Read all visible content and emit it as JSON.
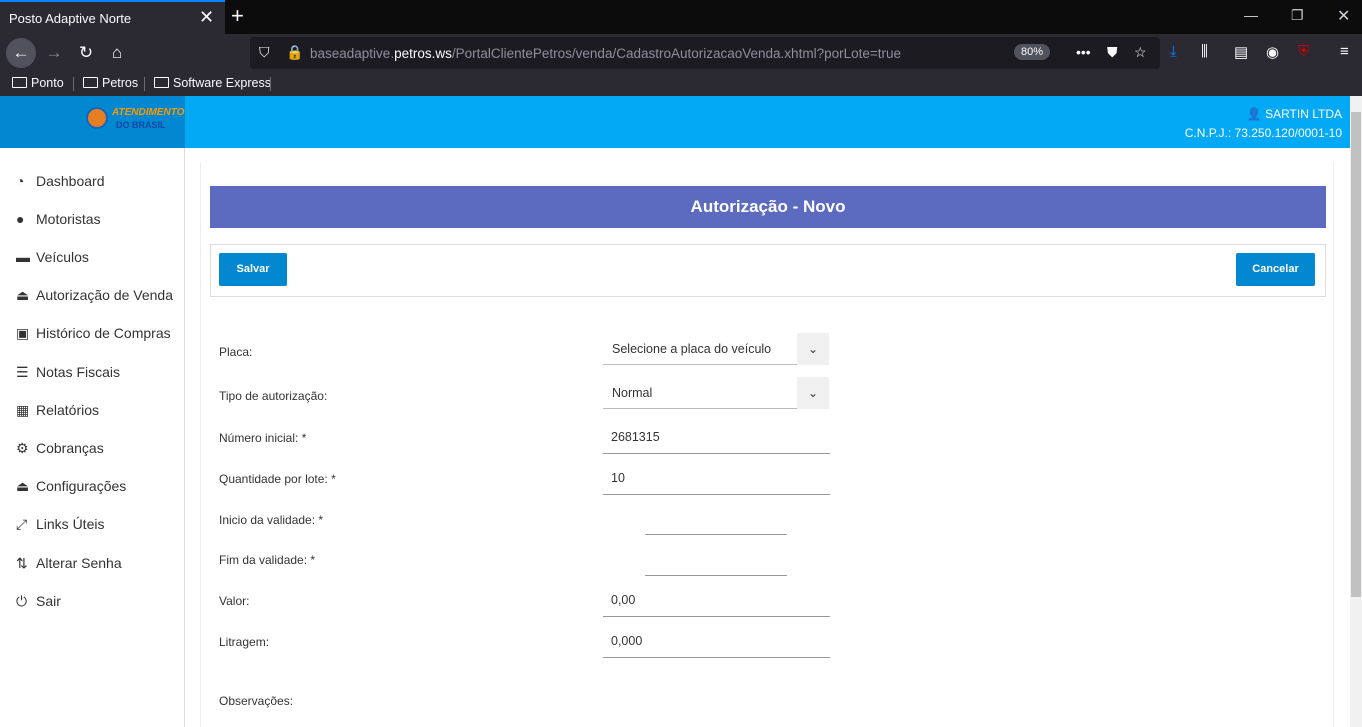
{
  "browser": {
    "tab_title": "Posto Adaptive Norte",
    "url_prefix": "baseadaptive.",
    "url_domain": "petros.ws",
    "url_path": "/PortalClientePetros/venda/CadastroAutorizacaoVenda.xhtml?porLote=true",
    "zoom": "80%",
    "bookmarks": [
      "Ponto",
      "Petros",
      "Software Express"
    ]
  },
  "header": {
    "logo_line1": "ATENDIMENTO",
    "logo_line2": "DO BRASIL",
    "user_name": "SARTIN LTDA",
    "cnpj": "C.N.P.J.: 73.250.120/0001-10"
  },
  "sidebar": {
    "items": [
      {
        "label": "Dashboard",
        "icon": "dashboard-icon"
      },
      {
        "label": "Motoristas",
        "icon": "user-icon"
      },
      {
        "label": "Veículos",
        "icon": "car-icon"
      },
      {
        "label": "Autorização de Venda",
        "icon": "basket-icon"
      },
      {
        "label": "Histórico de Compras",
        "icon": "bus-icon"
      },
      {
        "label": "Notas Fiscais",
        "icon": "list-icon"
      },
      {
        "label": "Relatórios",
        "icon": "table-icon"
      },
      {
        "label": "Cobranças",
        "icon": "gears-icon"
      },
      {
        "label": "Configurações",
        "icon": "basket-icon"
      },
      {
        "label": "Links Úteis",
        "icon": "expand-icon"
      },
      {
        "label": "Alterar Senha",
        "icon": "swap-icon"
      },
      {
        "label": "Sair",
        "icon": "power-icon"
      }
    ]
  },
  "form": {
    "title": "Autorização - Novo",
    "save_label": "Salvar",
    "cancel_label": "Cancelar",
    "placa_label": "Placa:",
    "placa_value": "Selecione a placa do veículo",
    "tipo_label": "Tipo de autorização:",
    "tipo_value": "Normal",
    "numero_label": "Número inicial:  *",
    "numero_value": "2681315",
    "quantidade_label": "Quantidade por lote:  *",
    "quantidade_value": "10",
    "inicio_label": "Inicio da validade:  *",
    "inicio_value": "",
    "fim_label": "Fim da validade:  *",
    "fim_value": "",
    "valor_label": "Valor:",
    "valor_value": "0,00",
    "litragem_label": "Litragem:",
    "litragem_value": "0,000",
    "observacoes_label": "Observações:"
  }
}
